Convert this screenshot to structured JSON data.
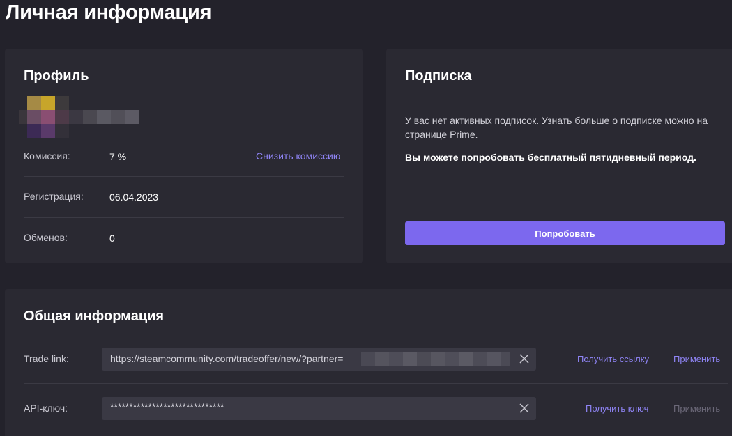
{
  "page": {
    "title": "Личная информация"
  },
  "profile": {
    "title": "Профиль",
    "rows": [
      {
        "label": "Комиссия:",
        "value": "7 %",
        "action": "Снизить комиссию"
      },
      {
        "label": "Регистрация:",
        "value": "06.04.2023"
      },
      {
        "label": "Обменов:",
        "value": "0"
      }
    ]
  },
  "subscription": {
    "title": "Подписка",
    "text": "У вас нет активных подписок. Узнать больше о подписке можно на странице Prime.",
    "bold_text": "Вы можете попробовать бесплатный пятидневный период.",
    "button_label": "Попробовать"
  },
  "general": {
    "title": "Общая информация",
    "trade_link": {
      "label": "Trade link:",
      "value": "https://steamcommunity.com/tradeoffer/new/?partner=",
      "get_label": "Получить ссылку",
      "apply_label": "Применить"
    },
    "api_key": {
      "label": "API-ключ:",
      "value": "******************************",
      "get_label": "Получить ключ",
      "apply_label": "Применить"
    }
  },
  "colors": {
    "background": "#23222b",
    "card": "#2a2932",
    "accent": "#7c68ee",
    "link": "#8f84f5",
    "disabled": "#6b6878"
  }
}
